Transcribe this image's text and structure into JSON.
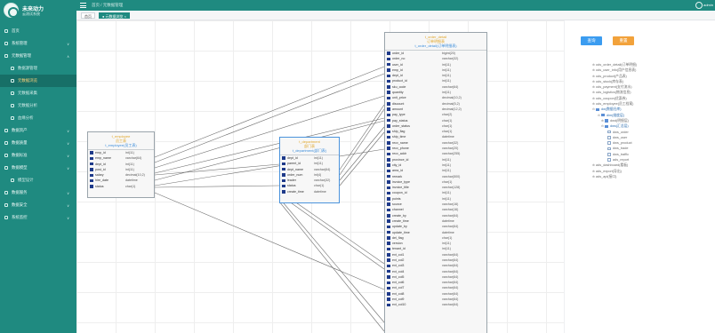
{
  "app": {
    "logo_line1": "未来动力",
    "logo_line2": "云测试系统"
  },
  "sidebar": {
    "items": [
      {
        "label": "首页"
      },
      {
        "label": "系统管理"
      },
      {
        "label": "元数据管理"
      },
      {
        "label": "数据源管理"
      },
      {
        "label": "元数据浏览"
      },
      {
        "label": "元数据采集"
      },
      {
        "label": "元数据分析"
      },
      {
        "label": "血缘分析"
      },
      {
        "label": "数据资产"
      },
      {
        "label": "数据质量"
      },
      {
        "label": "数据标准"
      },
      {
        "label": "数据模型"
      },
      {
        "label": "模型设计"
      },
      {
        "label": "数据服务"
      },
      {
        "label": "数据安全"
      },
      {
        "label": "系统监控"
      }
    ]
  },
  "topbar": {
    "breadcrumb": "首页 / 元数据管理",
    "user": "admin"
  },
  "tabs": [
    {
      "label": "首页"
    },
    {
      "label": "● 元数据浏览 ×"
    }
  ],
  "tables": {
    "left": {
      "name": "t_employee",
      "comment": "员工表",
      "tag": "t_employee(员工表)",
      "rows": [
        {
          "col": "emp_id",
          "type": "int(11)"
        },
        {
          "col": "emp_name",
          "type": "varchar(64)"
        },
        {
          "col": "dept_id",
          "type": "int(11)"
        },
        {
          "col": "post_id",
          "type": "int(11)"
        },
        {
          "col": "salary",
          "type": "decimal(10,2)"
        },
        {
          "col": "hire_date",
          "type": "datetime"
        },
        {
          "col": "status",
          "type": "char(1)"
        }
      ]
    },
    "middle": {
      "name": "t_department",
      "comment": "部门表",
      "tag": "t_department(部门表)",
      "rows": [
        {
          "col": "dept_id",
          "type": "int(11)"
        },
        {
          "col": "parent_id",
          "type": "int(11)"
        },
        {
          "col": "dept_name",
          "type": "varchar(64)"
        },
        {
          "col": "order_num",
          "type": "int(4)"
        },
        {
          "col": "leader",
          "type": "varchar(32)"
        },
        {
          "col": "status",
          "type": "char(1)"
        },
        {
          "col": "create_time",
          "type": "datetime"
        }
      ]
    },
    "main": {
      "name": "t_order_detail",
      "comment": "订单明细表",
      "tag": "t_order_detail(订单明细表)",
      "rows": [
        {
          "col": "order_id",
          "type": "bigint(20)"
        },
        {
          "col": "order_no",
          "type": "varchar(32)"
        },
        {
          "col": "user_id",
          "type": "int(11)"
        },
        {
          "col": "emp_id",
          "type": "int(11)"
        },
        {
          "col": "dept_id",
          "type": "int(11)"
        },
        {
          "col": "product_id",
          "type": "int(11)"
        },
        {
          "col": "sku_code",
          "type": "varchar(64)"
        },
        {
          "col": "quantity",
          "type": "int(11)"
        },
        {
          "col": "unit_price",
          "type": "decimal(10,2)"
        },
        {
          "col": "discount",
          "type": "decimal(5,2)"
        },
        {
          "col": "amount",
          "type": "decimal(12,2)"
        },
        {
          "col": "pay_type",
          "type": "char(2)"
        },
        {
          "col": "pay_status",
          "type": "char(1)"
        },
        {
          "col": "order_status",
          "type": "char(1)"
        },
        {
          "col": "ship_flag",
          "type": "char(1)"
        },
        {
          "col": "ship_time",
          "type": "datetime"
        },
        {
          "col": "recv_name",
          "type": "varchar(32)"
        },
        {
          "col": "recv_phone",
          "type": "varchar(20)"
        },
        {
          "col": "recv_addr",
          "type": "varchar(255)"
        },
        {
          "col": "province_id",
          "type": "int(11)"
        },
        {
          "col": "city_id",
          "type": "int(11)"
        },
        {
          "col": "area_id",
          "type": "int(11)"
        },
        {
          "col": "remark",
          "type": "varchar(500)"
        },
        {
          "col": "invoice_type",
          "type": "char(1)"
        },
        {
          "col": "invoice_title",
          "type": "varchar(128)"
        },
        {
          "col": "coupon_id",
          "type": "int(11)"
        },
        {
          "col": "points",
          "type": "int(11)"
        },
        {
          "col": "source",
          "type": "varchar(16)"
        },
        {
          "col": "channel",
          "type": "varchar(16)"
        },
        {
          "col": "create_by",
          "type": "varchar(64)"
        },
        {
          "col": "create_time",
          "type": "datetime"
        },
        {
          "col": "update_by",
          "type": "varchar(64)"
        },
        {
          "col": "update_time",
          "type": "datetime"
        },
        {
          "col": "del_flag",
          "type": "char(1)"
        },
        {
          "col": "version",
          "type": "int(11)"
        },
        {
          "col": "tenant_id",
          "type": "int(11)"
        },
        {
          "col": "ext_col1",
          "type": "varchar(64)"
        },
        {
          "col": "ext_col2",
          "type": "varchar(64)"
        },
        {
          "col": "ext_col3",
          "type": "varchar(64)"
        },
        {
          "col": "ext_col4",
          "type": "varchar(64)"
        },
        {
          "col": "ext_col5",
          "type": "varchar(64)"
        },
        {
          "col": "ext_col6",
          "type": "varchar(64)"
        },
        {
          "col": "ext_col7",
          "type": "varchar(64)"
        },
        {
          "col": "ext_col8",
          "type": "varchar(64)"
        },
        {
          "col": "ext_col9",
          "type": "varchar(64)"
        },
        {
          "col": "ext_col10",
          "type": "varchar(64)"
        }
      ]
    }
  },
  "rpanel": {
    "btn1": "查询",
    "btn2": "重置",
    "tree": [
      {
        "label": "ods_order_detail(订单明细)"
      },
      {
        "label": "ods_user_info(用户信息表)"
      },
      {
        "label": "ods_product(产品表)"
      },
      {
        "label": "ods_stock(库存表)"
      },
      {
        "label": "ods_payment(支付流水)"
      },
      {
        "label": "ods_logistics(物流信息)"
      },
      {
        "label": "ods_coupon(优惠券)"
      },
      {
        "label": "ods_employee(员工档案)"
      },
      {
        "label": "dw(数据仓库)"
      },
      {
        "label": "dim(维度层)"
      },
      {
        "label": "dwd(明细层)"
      },
      {
        "label": "dws(汇总层)"
      },
      {
        "label": "dws_order"
      },
      {
        "label": "dws_user"
      },
      {
        "label": "dws_product"
      },
      {
        "label": "dws_trade"
      },
      {
        "label": "dws_traffic"
      },
      {
        "label": "ads_report"
      },
      {
        "label": "ads_dashboard(看板)"
      },
      {
        "label": "ads_export(导出)"
      },
      {
        "label": "ads_api(接口)"
      }
    ]
  }
}
